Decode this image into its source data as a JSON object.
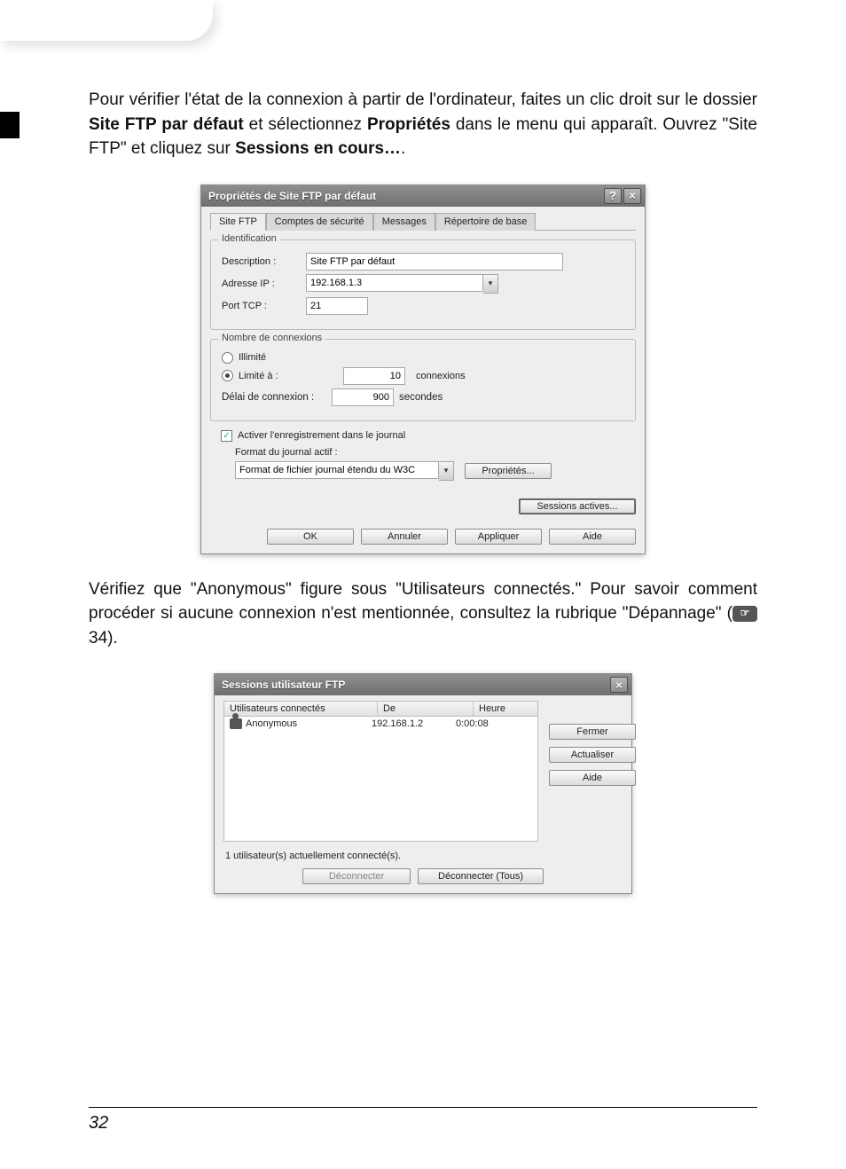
{
  "para1": {
    "pre": "Pour vérifier l'état de la connexion à partir de l'ordinateur, faites un clic droit sur le dossier ",
    "bold1": "Site FTP par défaut",
    "mid": " et sélectionnez ",
    "bold2": "Propriétés",
    "tail": " dans le menu qui apparaît. Ouvrez \"Site FTP\" et cliquez sur ",
    "bold3": "Sessions en cours…",
    "dot": "."
  },
  "dlg1": {
    "title": "Propriétés de Site FTP par défaut",
    "tabs": [
      "Site FTP",
      "Comptes de sécurité",
      "Messages",
      "Répertoire de base"
    ],
    "group1": {
      "title": "Identification",
      "desc_lbl": "Description :",
      "desc_val": "Site FTP par défaut",
      "ip_lbl": "Adresse IP :",
      "ip_val": "192.168.1.3",
      "port_lbl": "Port TCP :",
      "port_val": "21"
    },
    "group2": {
      "title": "Nombre de connexions",
      "opt_unlim": "Illimité",
      "opt_lim": "Limité à :",
      "lim_val": "10",
      "lim_unit": "connexions",
      "delay_lbl": "Délai de connexion :",
      "delay_val": "900",
      "delay_unit": "secondes"
    },
    "chk_log": "Activer l'enregistrement dans le journal",
    "log_lbl": "Format du journal actif :",
    "log_combo": "Format de fichier journal étendu du W3C",
    "btn_props": "Propriétés...",
    "btn_sessions": "Sessions actives...",
    "ok": "OK",
    "cancel": "Annuler",
    "apply": "Appliquer",
    "help": "Aide"
  },
  "para2_pre": "Vérifiez que \"Anonymous\" figure sous \"Utilisateurs connectés.\"  Pour savoir comment procéder si aucune connexion n'est mentionnée, consultez la rubrique \"Dépannage\" (",
  "para2_ref": "34",
  "para2_post": ").",
  "dlg2": {
    "title": "Sessions utilisateur FTP",
    "hdr_user": "Utilisateurs connectés",
    "hdr_de": "De",
    "hdr_heure": "Heure",
    "row_user": "Anonymous",
    "row_de": "192.168.1.2",
    "row_heure": "0:00:08",
    "status": "1 utilisateur(s) actuellement connecté(s).",
    "btn_close": "Fermer",
    "btn_refresh": "Actualiser",
    "btn_help": "Aide",
    "btn_disc": "Déconnecter",
    "btn_disc_all": "Déconnecter (Tous)"
  },
  "pagenum": "32"
}
